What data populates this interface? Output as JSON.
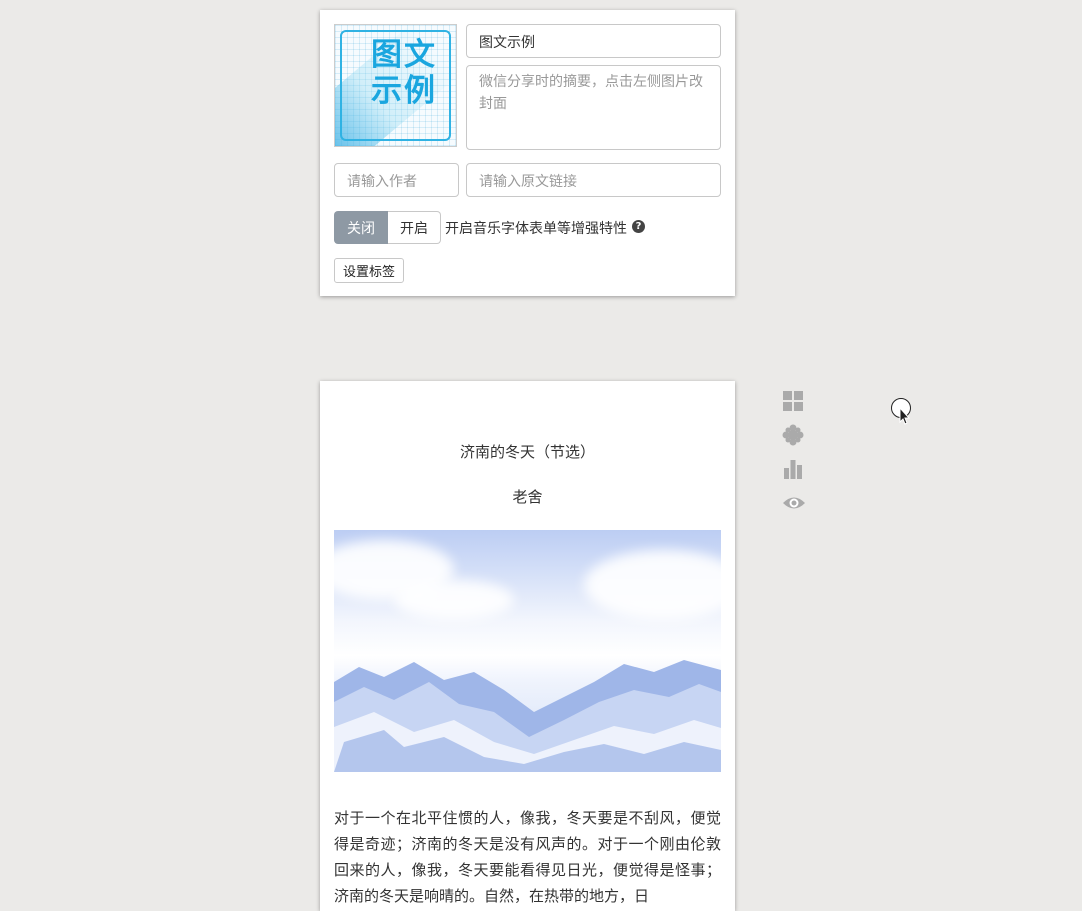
{
  "meta_card": {
    "cover": {
      "line1": "图文",
      "line2": "示例"
    },
    "title_value": "图文示例",
    "digest_placeholder": "微信分享时的摘要，点击左侧图片改封面",
    "author_placeholder": "请输入作者",
    "source_placeholder": "请输入原文链接",
    "toggle": {
      "off_label": "关闭",
      "on_label": "开启",
      "selected": "关闭"
    },
    "enhance_label": "开启音乐字体表单等增强特性",
    "help_glyph": "?",
    "tag_button": "设置标签"
  },
  "article": {
    "title": "济南的冬天（节选）",
    "author": "老舍",
    "body": "对于一个在北平住惯的人，像我，冬天要是不刮风，便觉得是奇迹；济南的冬天是没有风声的。对于一个刚由伦敦回来的人，像我，冬天要能看得见日光，便觉得是怪事；济南的冬天是响晴的。自然，在热带的地方，日"
  },
  "side_tools": [
    {
      "name": "grid-icon"
    },
    {
      "name": "puzzle-icon"
    },
    {
      "name": "bar-chart-icon"
    },
    {
      "name": "eye-icon"
    }
  ],
  "colors": {
    "toggle_active": "#8e99a4",
    "cover_accent": "#1aa6df",
    "tool_icon": "#aaaaaa",
    "background": "#ebeae8"
  }
}
